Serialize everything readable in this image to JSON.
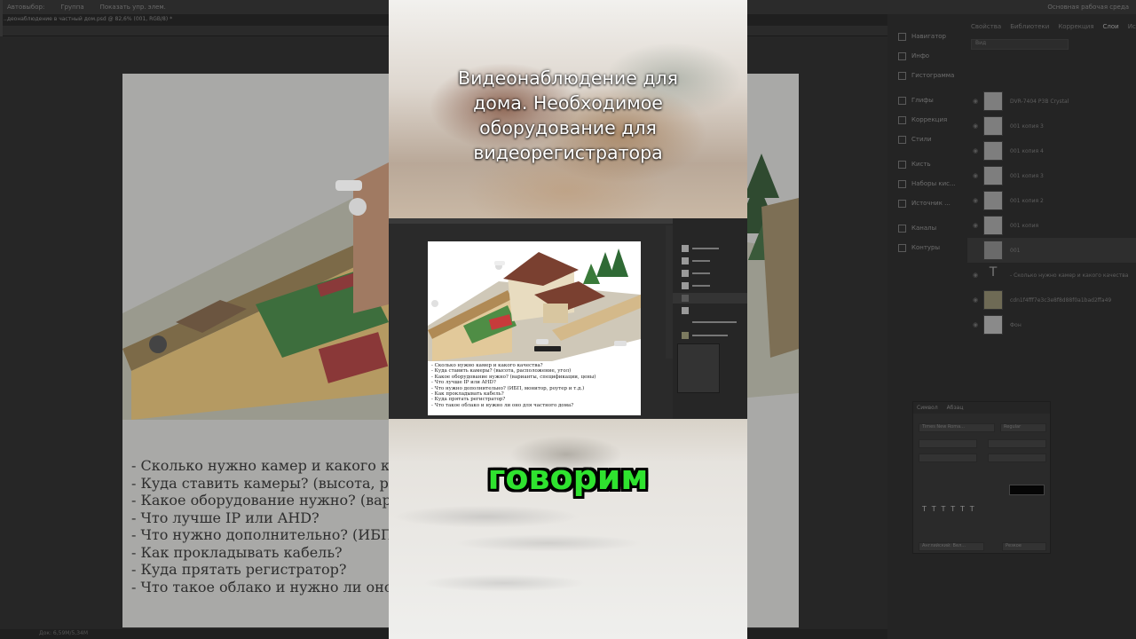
{
  "photoshop": {
    "topbar": {
      "items": [
        "Автовыбор:",
        "Группа",
        "Показать упр. элем."
      ],
      "workspace": "Основная рабочая среда"
    },
    "doc_tab": "..деонаблюдение в частный дом.psd @ 82,6% (001, RGB/8) *",
    "status": "Док: 6,59M/5,34M",
    "panels": {
      "tabs": [
        "Свойства",
        "Библиотеки",
        "Коррекция",
        "Слои",
        "Источники"
      ],
      "side_items": [
        "Навигатор",
        "Инфо",
        "Гистограмма",
        "Глифы",
        "Коррекция",
        "Стили",
        "Кисть",
        "Наборы кис...",
        "Источник ...",
        "Каналы",
        "Контуры"
      ],
      "search_placeholder": "Вид",
      "layers": [
        "DVR-7404 P3B Crystal",
        "001 копия 3",
        "001 копия 4",
        "001 копия 3",
        "001 копия 2",
        "001 копия",
        "001",
        "- Сколько нужно камер и какого качества",
        "cdn1f4fff7e3c3e8f8d88f0a1bad2ffa49",
        "Фон"
      ],
      "character_tabs": [
        "Символ",
        "Абзац"
      ],
      "font_name": "Times New Roma...",
      "font_style": "Regular",
      "language": "Английский: Вел...",
      "aa": "Резкое"
    }
  },
  "document": {
    "questions": [
      "- Сколько нужно камер и какого к",
      "- Куда ставить камеры? (высота, р",
      "- Какое оборудование нужно? (вар",
      "- Что лучше IP или AHD?",
      "- Что нужно дополнительно? (ИБП",
      "- Как прокладывать кабель?",
      "- Куда прятать регистратор?",
      "- Что такое облако и нужно ли оно"
    ]
  },
  "video": {
    "title_lines": [
      "Видеонаблюдение для",
      "дома. Необходимое",
      "оборудование для",
      "видеорегистратора"
    ],
    "caption": "говорим",
    "mini_questions": [
      "- Сколько нужно камер и какого качества?",
      "- Куда ставить камеры? (высота, расположение, угол)",
      "- Какое оборудование нужно? (варианты, спецификации, цены)",
      "- Что лучше IP или AHD?",
      "- Что нужно дополнительно? (ИБП, монитор, роутер и т.д.)",
      "- Как прокладывать кабель?",
      "- Куда прятать регистратор?",
      "- Что такое облако и нужно ли оно для частного дома?"
    ]
  },
  "colors": {
    "caption_green": "#2fe32f",
    "ps_dark": "#262626"
  }
}
